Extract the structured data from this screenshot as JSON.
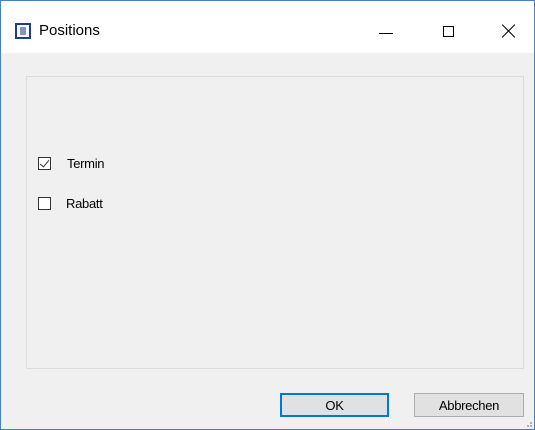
{
  "window": {
    "title": "Positions",
    "icons": {
      "app": "app-icon",
      "minimize": "minimize-icon",
      "maximize": "maximize-icon",
      "close": "close-icon"
    }
  },
  "options": {
    "items": [
      {
        "label": "Termin",
        "checked": true
      },
      {
        "label": "Rabatt",
        "checked": false
      }
    ]
  },
  "buttons": {
    "ok_label": "OK",
    "cancel_label": "Abbrechen"
  },
  "colors": {
    "accent": "#0078d7",
    "window_border": "#4a7fbf",
    "client_bg": "#f0f0f0",
    "titlebar_bg": "#ffffff"
  }
}
